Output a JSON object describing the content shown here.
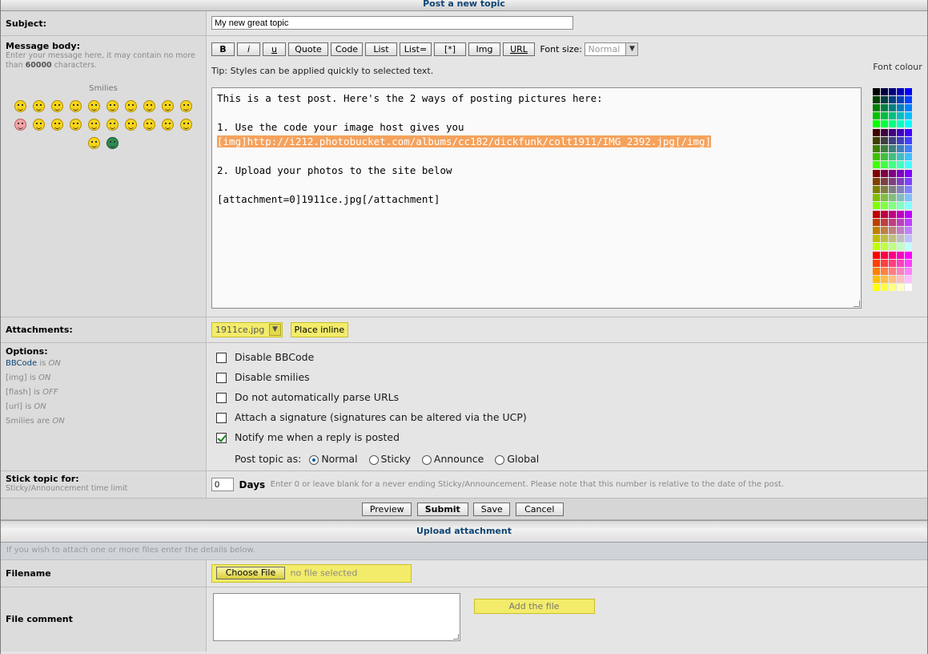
{
  "header": {
    "title": "Post a new topic"
  },
  "subject": {
    "label": "Subject:",
    "value": "My new great topic"
  },
  "message": {
    "label": "Message body:",
    "hint_pre": "Enter your message here, it may contain no more than ",
    "hint_num": "60000",
    "hint_post": " characters.",
    "smilies_label": "Smilies",
    "toolbar": {
      "bold": "B",
      "italic": "i",
      "underline": "u",
      "quote": "Quote",
      "code": "Code",
      "list": "List",
      "list_eq": "List=",
      "star": "[*]",
      "img": "Img",
      "url": "URL",
      "font_size_label": "Font size:",
      "font_size_value": "Normal"
    },
    "tip": "Tip: Styles can be applied quickly to selected text.",
    "font_colour_label": "Font colour",
    "body_lines": [
      "This is a test post. Here's the 2 ways of posting pictures here:",
      "",
      "1. Use the code your image host gives you",
      "[img]http://i212.photobucket.com/albums/cc182/dickfunk/colt1911/IMG_2392.jpg[/img]",
      "",
      "2. Upload your photos to the site below",
      "",
      "[attachment=0]1911ce.jpg[/attachment]"
    ]
  },
  "attachments": {
    "label": "Attachments:",
    "selected": "1911ce.jpg",
    "place_inline": "Place inline"
  },
  "options": {
    "label": "Options:",
    "status": [
      {
        "name": "BBCode",
        "is": "is",
        "state": "ON"
      },
      {
        "name": "[img]",
        "is": "is",
        "state": "ON"
      },
      {
        "name": "[flash]",
        "is": "is",
        "state": "OFF"
      },
      {
        "name": "[url]",
        "is": "is",
        "state": "ON"
      },
      {
        "name": "Smilies",
        "is": "are",
        "state": "ON"
      }
    ],
    "checks": [
      {
        "label": "Disable BBCode",
        "checked": false
      },
      {
        "label": "Disable smilies",
        "checked": false
      },
      {
        "label": "Do not automatically parse URLs",
        "checked": false
      },
      {
        "label": "Attach a signature (signatures can be altered via the UCP)",
        "checked": false
      },
      {
        "label": "Notify me when a reply is posted",
        "checked": true
      }
    ],
    "post_as_label": "Post topic as:",
    "post_as": [
      {
        "label": "Normal",
        "selected": true
      },
      {
        "label": "Sticky",
        "selected": false
      },
      {
        "label": "Announce",
        "selected": false
      },
      {
        "label": "Global",
        "selected": false
      }
    ]
  },
  "stick": {
    "label": "Stick topic for:",
    "sub": "Sticky/Announcement time limit",
    "value": "0",
    "unit": "Days",
    "note": "Enter 0 or leave blank for a never ending Sticky/Announcement. Please note that this number is relative to the date of the post."
  },
  "actions": {
    "preview": "Preview",
    "submit": "Submit",
    "save": "Save",
    "cancel": "Cancel"
  },
  "upload": {
    "title": "Upload attachment",
    "hint": "If you wish to attach one or more files enter the details below.",
    "filename_label": "Filename",
    "choose_file": "Choose File",
    "no_file": "no file selected",
    "comment_label": "File comment",
    "add_file": "Add the file"
  },
  "colors": {
    "highlight": "#f3ec6b",
    "selection": "#f5a25d",
    "link": "#0d4473"
  }
}
